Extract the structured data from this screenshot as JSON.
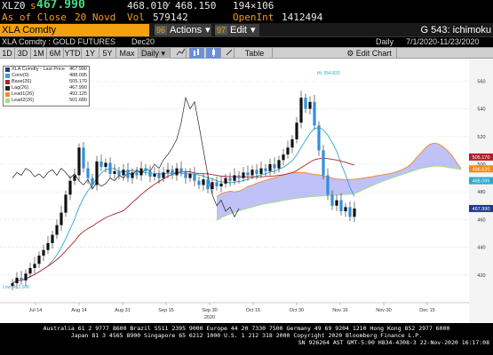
{
  "quote": {
    "ticker": "XLZ0",
    "price_prefix": "s",
    "price": "467.990",
    "bid": "468.010",
    "ask": "468.150",
    "size": "194×106",
    "asof_label": "As of Close",
    "asof_date": "20 Novd",
    "vol_label": "Vol",
    "vol": "579142",
    "oi_label": "OpenInt",
    "oi": "1412494"
  },
  "toolbar": {
    "security": "XLA Comdty",
    "actions_num": "96",
    "actions_label": "Actions",
    "edit_num": "97",
    "edit_label": "Edit",
    "function_title": "G 543: ichimoku"
  },
  "subheader": {
    "security_name": "XLA Comdty : GOLD FUTURES",
    "contract": "Dec20",
    "period": "Daily",
    "date_range": "7/1/2020-11/23/2020"
  },
  "ranges": [
    "1D",
    "3D",
    "1M",
    "6M",
    "YTD",
    "1Y",
    "5Y",
    "Max"
  ],
  "period_select": "Daily ▾",
  "table_label": "Table",
  "edit_chart_label": "Edit Chart",
  "legend": {
    "rows": [
      {
        "label": "XLA Comdty - Last Price",
        "value": "467.990",
        "color": "#1f3a93"
      },
      {
        "label": "Conv(9)",
        "value": "488.095",
        "color": "#2ca7c9"
      },
      {
        "label": "Base(26)",
        "value": "505.170",
        "color": "#b21f2d"
      },
      {
        "label": "Lag(26)",
        "value": "467.990",
        "color": "#222222"
      },
      {
        "label": "Lead1(26)",
        "value": "492.125",
        "color": "#f08a24"
      },
      {
        "label": "Lead2(26)",
        "value": "501.680",
        "color": "#9be07a"
      }
    ]
  },
  "annotations": {
    "high": "Hi: 554.820",
    "low": "Low: 412.000"
  },
  "chart_data": {
    "type": "line",
    "title": "",
    "ylim": [
      400,
      575
    ],
    "y_ticks": [
      420,
      440,
      460,
      480,
      500,
      520,
      540,
      560
    ],
    "x_tick_labels": [
      "Jul 14",
      "Aug 14",
      "Aug 31",
      "Sep 15",
      "Sep 30",
      "Oct 15",
      "Oct 30",
      "Nov 16",
      "Nov 30",
      "Dec 15"
    ],
    "x_year": "2020",
    "price_tags": [
      {
        "value": "505.170",
        "color": "#b21f2d"
      },
      {
        "value": "496.620",
        "color": "#f08a24"
      },
      {
        "value": "488.095",
        "color": "#2ca7c9"
      },
      {
        "value": "467.990",
        "color": "#1f3a93"
      }
    ],
    "candles_close": [
      414,
      418,
      416,
      421,
      425,
      428,
      434,
      438,
      443,
      449,
      456,
      465,
      478,
      488,
      492,
      512,
      497,
      490,
      485,
      502,
      498,
      501,
      493,
      495,
      492,
      496,
      490,
      494,
      492,
      497,
      495,
      491,
      493,
      490,
      494,
      496,
      492,
      497,
      494,
      490,
      493,
      488,
      485,
      489,
      482,
      487,
      484,
      486,
      490,
      488,
      492,
      490,
      494,
      492,
      496,
      493,
      497,
      495,
      500,
      497,
      503,
      507,
      512,
      518,
      530,
      548,
      540,
      545,
      528,
      510,
      492,
      478,
      470,
      474,
      466,
      469,
      462,
      468
    ],
    "series": [
      {
        "name": "Conv(9)",
        "color": "#2ca7c9"
      },
      {
        "name": "Base(26)",
        "color": "#b21f2d"
      },
      {
        "name": "Lag(26)",
        "color": "#222222"
      },
      {
        "name": "Lead1(26)",
        "color": "#f08a24"
      },
      {
        "name": "Lead2(26)",
        "color": "#9be07a"
      }
    ]
  },
  "footer": {
    "line1": "Australia 61 2 9777 8600  Brazil 5511 2395 9000  Europe 44 20 7330 7500  Germany 49 69 9204 1210  Hong Kong 852 2977 6000",
    "line2": "Japan 81 3 4565 8900        Singapore 65 6212 1000        U.S. 1 212 318 2000        Copyright 2020 Bloomberg Finance L.P.",
    "line3": "SN 926264 AST  GMT-5:00 H834-4308-3 22-Nov-2020 16:17:08"
  }
}
